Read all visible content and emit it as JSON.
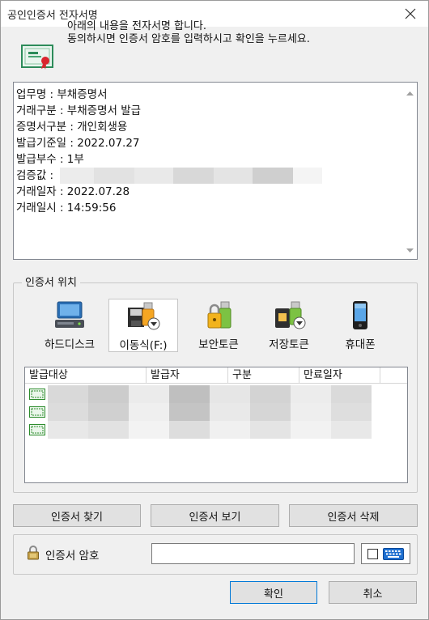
{
  "window": {
    "title": "공인인증서 전자서명"
  },
  "header": {
    "line1": "아래의 내용을 전자서명 합니다.",
    "line2": "동의하시면 인증서 암호를 입력하시고 확인을 누르세요."
  },
  "info": {
    "rows": [
      "업무명 : 부채증명서",
      "거래구분 : 부채증명서 발급",
      "증명서구분 : 개인회생용",
      "발급기준일 : 2022.07.27",
      "발급부수 : 1부",
      "검증값 :",
      "거래일자 : 2022.07.28",
      "거래일시 : 14:59:56"
    ]
  },
  "location": {
    "legend": "인증서 위치",
    "items": [
      {
        "label": "하드디스크",
        "icon": "computer-icon",
        "selected": false
      },
      {
        "label": "이동식(F:)",
        "icon": "removable-disk-icon",
        "selected": true
      },
      {
        "label": "보안토큰",
        "icon": "security-token-icon",
        "selected": false
      },
      {
        "label": "저장토큰",
        "icon": "storage-token-icon",
        "selected": false
      },
      {
        "label": "휴대폰",
        "icon": "mobile-phone-icon",
        "selected": false
      }
    ]
  },
  "certlist": {
    "columns": [
      "발급대상",
      "발급자",
      "구분",
      "만료일자"
    ],
    "row_count": 3
  },
  "buttons": {
    "find": "인증서 찾기",
    "view": "인증서 보기",
    "delete": "인증서 삭제",
    "ok": "확인",
    "cancel": "취소"
  },
  "password": {
    "label": "인증서 암호",
    "value": ""
  },
  "colors": {
    "primary_border": "#0078d7",
    "window_bg": "#f0f0f0"
  }
}
